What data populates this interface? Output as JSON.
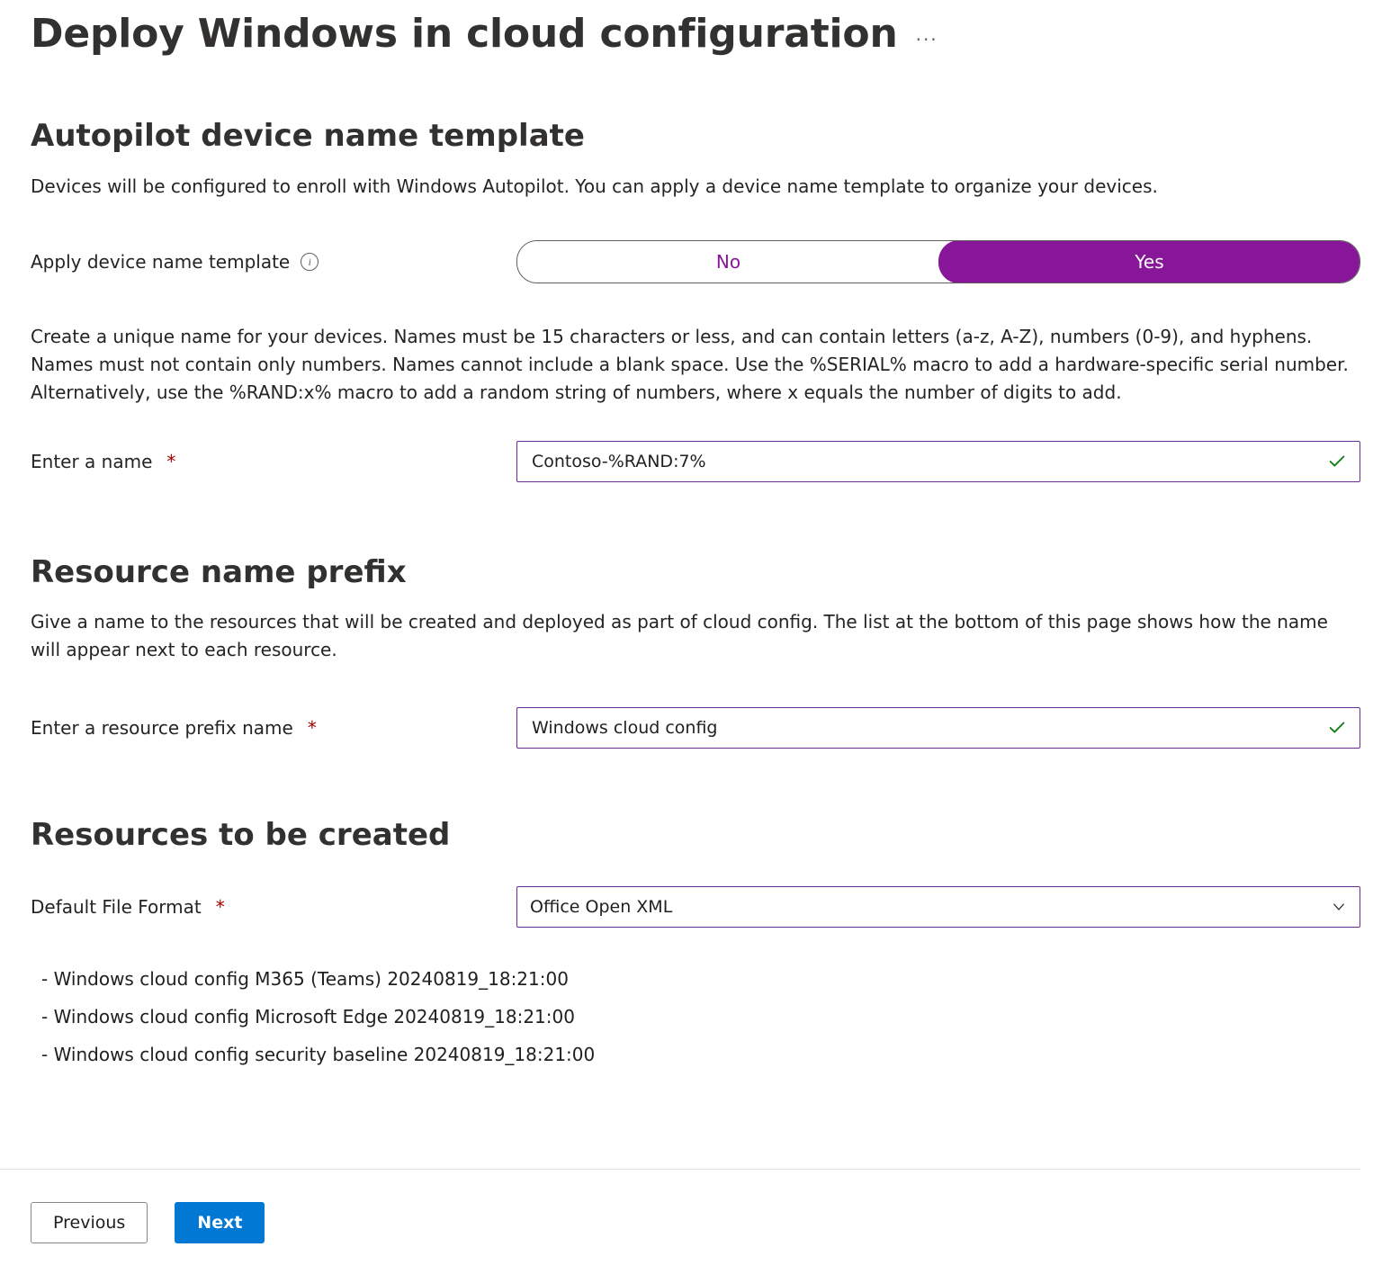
{
  "header": {
    "title": "Deploy Windows in cloud configuration",
    "more_icon": "more-icon"
  },
  "section_autopilot": {
    "heading": "Autopilot device name template",
    "description": "Devices will be configured to enroll with Windows Autopilot. You can apply a device name template to organize your devices.",
    "toggle": {
      "label": "Apply device name template",
      "info_icon": "info-icon",
      "option_no": "No",
      "option_yes": "Yes",
      "selected": "Yes"
    },
    "rules": "Create a unique name for your devices. Names must be 15 characters or less, and can contain letters (a-z, A-Z), numbers (0-9), and hyphens. Names must not contain only numbers. Names cannot include a blank space. Use the %SERIAL% macro to add a hardware-specific serial number. Alternatively, use the %RAND:x% macro to add a random string of numbers, where x equals the number of digits to add.",
    "name_field": {
      "label": "Enter a name",
      "required": true,
      "value": "Contoso-%RAND:7%",
      "valid": true
    }
  },
  "section_prefix": {
    "heading": "Resource name prefix",
    "description": "Give a name to the resources that will be created and deployed as part of cloud config. The list at the bottom of this page shows how the name will appear next to each resource.",
    "prefix_field": {
      "label": "Enter a resource prefix name",
      "required": true,
      "value": "Windows cloud config",
      "valid": true
    }
  },
  "section_resources": {
    "heading": "Resources to be created",
    "format_field": {
      "label": "Default File Format",
      "required": true,
      "value": "Office Open XML"
    },
    "items": [
      "Windows cloud config M365 (Teams) 20240819_18:21:00",
      "Windows cloud config Microsoft Edge 20240819_18:21:00",
      "Windows cloud config security baseline 20240819_18:21:00"
    ]
  },
  "footer": {
    "previous": "Previous",
    "next": "Next"
  }
}
